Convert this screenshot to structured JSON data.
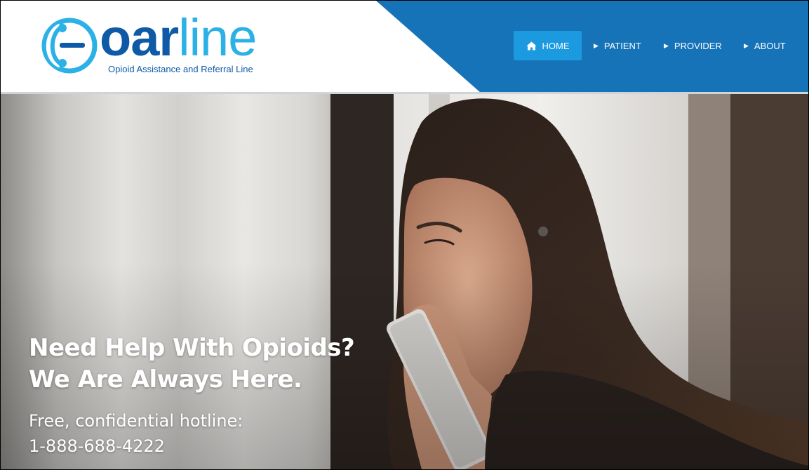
{
  "brand": {
    "logo_bold": "oar",
    "logo_light": "line",
    "tagline": "Opioid Assistance and Referral Line",
    "colors": {
      "dark_blue": "#0e5aa6",
      "light_blue": "#2bb1e6",
      "header_band": "#1673b8",
      "active_nav": "#1c9ae0"
    }
  },
  "nav": {
    "items": [
      {
        "label": "HOME",
        "icon": "home-icon",
        "active": true
      },
      {
        "label": "PATIENT",
        "icon": "caret-right-icon",
        "active": false
      },
      {
        "label": "PROVIDER",
        "icon": "caret-right-icon",
        "active": false
      },
      {
        "label": "ABOUT",
        "icon": "caret-right-icon",
        "active": false
      }
    ]
  },
  "hero": {
    "headline_line1": "Need Help With Opioids?",
    "headline_line2": "We Are Always Here.",
    "sub_line1": "Free, confidential hotline:",
    "sub_line2": "1-888-688-4222",
    "image": "woman-on-phone-photo"
  }
}
